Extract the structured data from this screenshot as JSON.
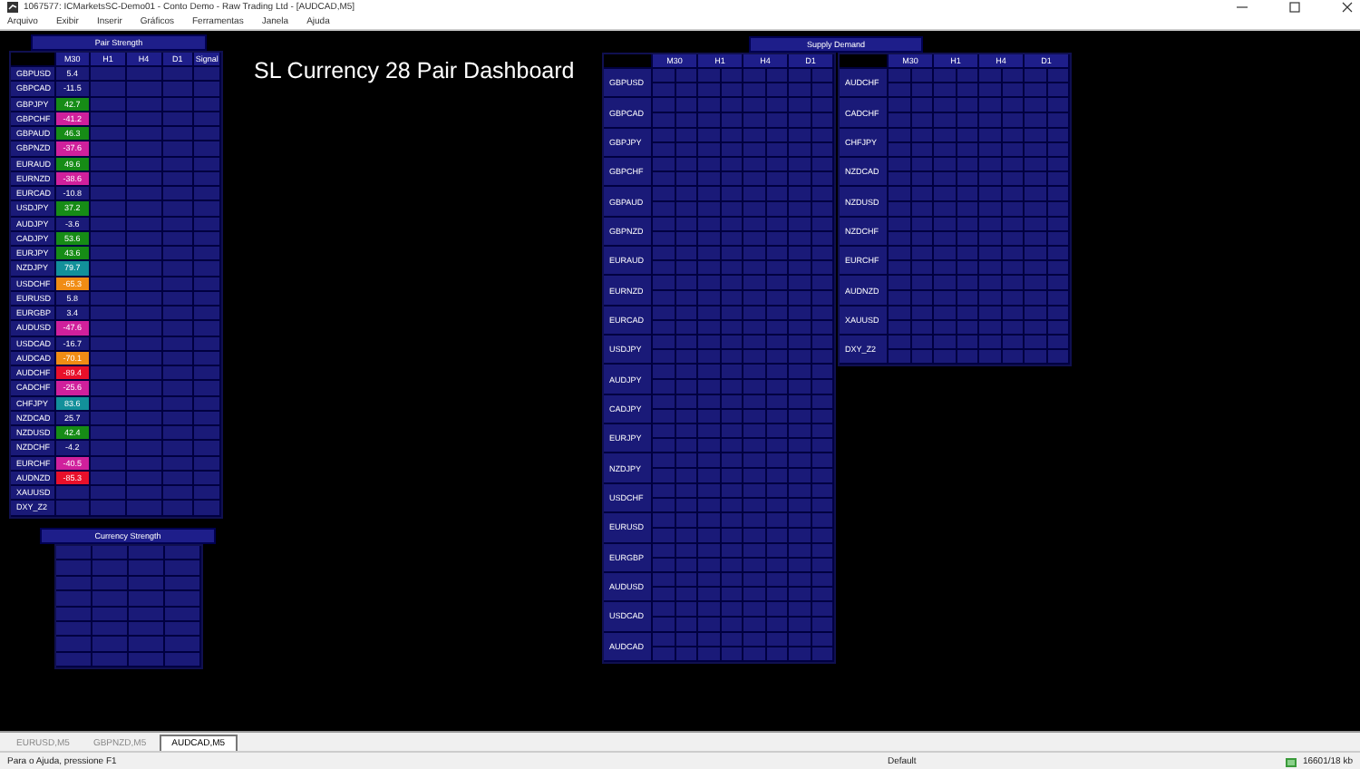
{
  "window": {
    "title": "1067577: ICMarketsSC-Demo01 - Conto Demo - Raw Trading Ltd - [AUDCAD,M5]"
  },
  "menu": [
    "Arquivo",
    "Exibir",
    "Inserir",
    "Gráficos",
    "Ferramentas",
    "Janela",
    "Ajuda"
  ],
  "chart": {
    "title": "SL Currency 28 Pair Dashboard",
    "pair_strength": {
      "title": "Pair Strength",
      "columns": [
        "M30",
        "H1",
        "H4",
        "D1",
        "Signal"
      ],
      "rows": [
        {
          "pair": "GBPUSD",
          "m30": "5.4"
        },
        {
          "pair": "GBPCAD",
          "m30": "-11.5"
        },
        {
          "pair": "GBPJPY",
          "m30": "42.7",
          "color": "#168c16"
        },
        {
          "pair": "GBPCHF",
          "m30": "-41.2",
          "color": "#d0209c"
        },
        {
          "pair": "GBPAUD",
          "m30": "46.3",
          "color": "#168c16"
        },
        {
          "pair": "GBPNZD",
          "m30": "-37.6",
          "color": "#d0209c"
        },
        {
          "pair": "EURAUD",
          "m30": "49.6",
          "color": "#168c16"
        },
        {
          "pair": "EURNZD",
          "m30": "-38.6",
          "color": "#d0209c"
        },
        {
          "pair": "EURCAD",
          "m30": "-10.8"
        },
        {
          "pair": "USDJPY",
          "m30": "37.2",
          "color": "#168c16"
        },
        {
          "pair": "AUDJPY",
          "m30": "-3.6"
        },
        {
          "pair": "CADJPY",
          "m30": "53.6",
          "color": "#168c16"
        },
        {
          "pair": "EURJPY",
          "m30": "43.6",
          "color": "#168c16"
        },
        {
          "pair": "NZDJPY",
          "m30": "79.7",
          "color": "#12909a"
        },
        {
          "pair": "USDCHF",
          "m30": "-65.3",
          "color": "#f08c14"
        },
        {
          "pair": "EURUSD",
          "m30": "5.8"
        },
        {
          "pair": "EURGBP",
          "m30": "3.4"
        },
        {
          "pair": "AUDUSD",
          "m30": "-47.6",
          "color": "#d0209c"
        },
        {
          "pair": "USDCAD",
          "m30": "-16.7"
        },
        {
          "pair": "AUDCAD",
          "m30": "-70.1",
          "color": "#f08c14"
        },
        {
          "pair": "AUDCHF",
          "m30": "-89.4",
          "color": "#e8102a"
        },
        {
          "pair": "CADCHF",
          "m30": "-25.6",
          "color": "#d0209c"
        },
        {
          "pair": "CHFJPY",
          "m30": "83.6",
          "color": "#12909a"
        },
        {
          "pair": "NZDCAD",
          "m30": "25.7"
        },
        {
          "pair": "NZDUSD",
          "m30": "42.4",
          "color": "#168c16"
        },
        {
          "pair": "NZDCHF",
          "m30": "-4.2"
        },
        {
          "pair": "EURCHF",
          "m30": "-40.5",
          "color": "#d0209c"
        },
        {
          "pair": "AUDNZD",
          "m30": "-85.3",
          "color": "#e8102a"
        },
        {
          "pair": "XAUUSD"
        },
        {
          "pair": "DXY_Z2"
        }
      ]
    },
    "currency_strength": {
      "title": "Currency Strength"
    },
    "supply_demand": {
      "title": "Supply Demand",
      "tables": [
        {
          "columns": [
            "M30",
            "H1",
            "H4",
            "D1"
          ],
          "rows": [
            "GBPUSD",
            "GBPCAD",
            "GBPJPY",
            "GBPCHF",
            "GBPAUD",
            "GBPNZD",
            "EURAUD",
            "EURNZD",
            "EURCAD",
            "USDJPY",
            "AUDJPY",
            "CADJPY",
            "EURJPY",
            "NZDJPY",
            "USDCHF",
            "EURUSD",
            "EURGBP",
            "AUDUSD",
            "USDCAD",
            "AUDCAD"
          ]
        },
        {
          "columns": [
            "M30",
            "H1",
            "H4",
            "D1"
          ],
          "rows": [
            "AUDCHF",
            "CADCHF",
            "CHFJPY",
            "NZDCAD",
            "NZDUSD",
            "NZDCHF",
            "EURCHF",
            "AUDNZD",
            "XAUUSD",
            "DXY_Z2"
          ]
        }
      ]
    }
  },
  "chart_tabs": [
    {
      "label": "EURUSD,M5",
      "selected": false
    },
    {
      "label": "GBPNZD,M5",
      "selected": false
    },
    {
      "label": "AUDCAD,M5",
      "selected": true
    }
  ],
  "status_bar": {
    "help": "Para o Ajuda, pressione F1",
    "profile": "Default",
    "traffic": "16601/18 kb"
  }
}
